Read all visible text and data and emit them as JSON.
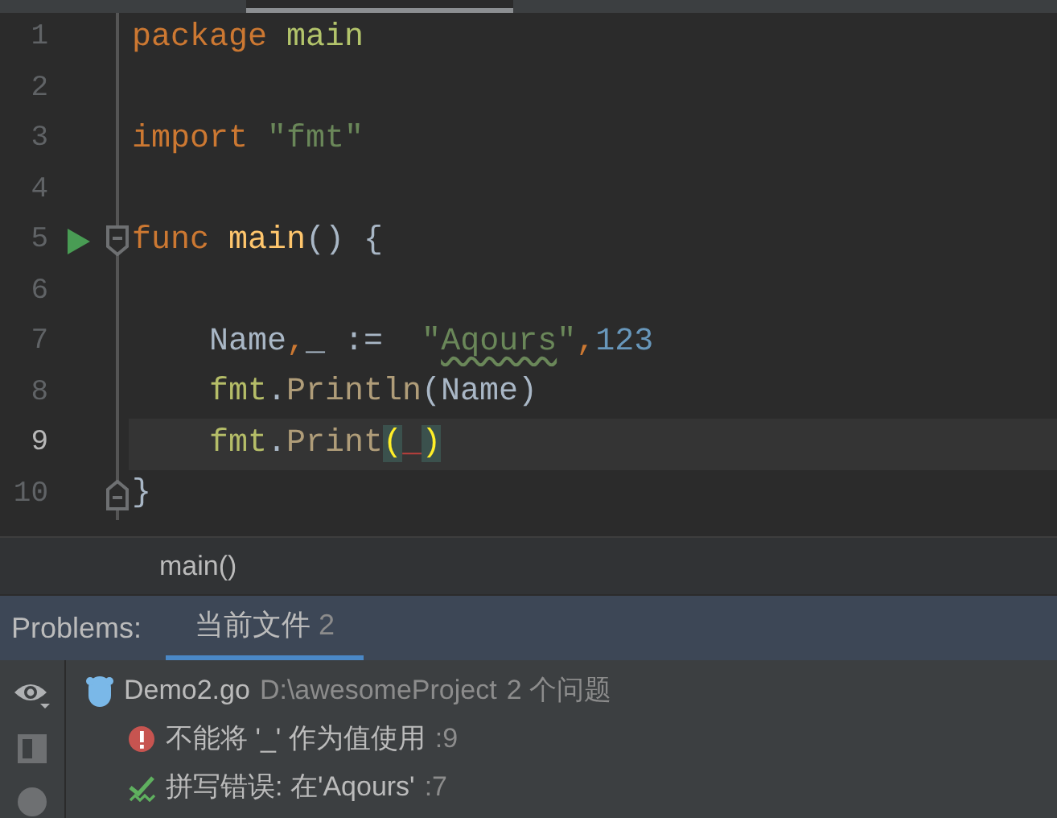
{
  "editor": {
    "lines": [
      {
        "number": "1",
        "current": false,
        "run_marker": false,
        "fold_open": false,
        "fold_close": false,
        "tokens": [
          {
            "text": "package ",
            "kind": "keyword"
          },
          {
            "text": "main",
            "kind": "package"
          }
        ]
      },
      {
        "number": "2",
        "current": false,
        "run_marker": false,
        "fold_open": false,
        "fold_close": false
      },
      {
        "number": "3",
        "current": false,
        "run_marker": false,
        "fold_open": false,
        "fold_close": false,
        "tokens": [
          {
            "text": "import ",
            "kind": "keyword"
          },
          {
            "text": "\"fmt\"",
            "kind": "string"
          }
        ]
      },
      {
        "number": "4",
        "current": false,
        "run_marker": false,
        "fold_open": false,
        "fold_close": false
      },
      {
        "number": "5",
        "current": false,
        "run_marker": true,
        "fold_open": true,
        "fold_close": false,
        "tokens": [
          {
            "text": "func ",
            "kind": "keyword"
          },
          {
            "text": "main",
            "kind": "function"
          },
          {
            "text": "() {",
            "kind": "plain"
          }
        ]
      },
      {
        "number": "6",
        "current": false,
        "run_marker": false,
        "fold_open": false,
        "fold_close": false
      },
      {
        "number": "7",
        "current": false,
        "run_marker": false,
        "fold_open": false,
        "fold_close": false,
        "tokens": [
          {
            "text": "    Name",
            "kind": "plain"
          },
          {
            "text": ",",
            "kind": "keyword"
          },
          {
            "text": "_ :=  ",
            "kind": "plain"
          },
          {
            "text": "\"",
            "kind": "string"
          },
          {
            "text": "Aqours",
            "kind": "typo"
          },
          {
            "text": "\"",
            "kind": "string"
          },
          {
            "text": ",",
            "kind": "keyword"
          },
          {
            "text": "123",
            "kind": "number"
          }
        ]
      },
      {
        "number": "8",
        "current": false,
        "run_marker": false,
        "fold_open": false,
        "fold_close": false,
        "tokens": [
          {
            "text": "    fmt",
            "kind": "module"
          },
          {
            "text": ".",
            "kind": "plain"
          },
          {
            "text": "Println",
            "kind": "method"
          },
          {
            "text": "(Name)",
            "kind": "plain"
          }
        ]
      },
      {
        "number": "9",
        "current": true,
        "run_marker": false,
        "fold_open": false,
        "fold_close": false,
        "tokens": [
          {
            "text": "    fmt",
            "kind": "module"
          },
          {
            "text": ".",
            "kind": "plain"
          },
          {
            "text": "Print",
            "kind": "method"
          },
          {
            "text": "(",
            "kind": "brace-match"
          },
          {
            "text": "_",
            "kind": "error"
          },
          {
            "text": ")",
            "kind": "brace-match"
          }
        ]
      },
      {
        "number": "10",
        "current": false,
        "run_marker": false,
        "fold_open": false,
        "fold_close": true,
        "tokens": [
          {
            "text": "}",
            "kind": "plain"
          }
        ]
      }
    ]
  },
  "breadcrumb": "main()",
  "problems": {
    "title": "Problems:",
    "tabs": [
      {
        "label": "当前文件",
        "count": "2",
        "selected": true
      }
    ],
    "tree": [
      {
        "file": "Demo2.go",
        "path": "D:\\awesomeProject",
        "summary": "2 个问题",
        "children": [
          {
            "kind": "error",
            "message": "不能将 '_' 作为值使用",
            "location": ":9"
          },
          {
            "kind": "typo",
            "message": "拼写错误: 在'Aqours'",
            "location": ":7"
          }
        ]
      }
    ]
  }
}
